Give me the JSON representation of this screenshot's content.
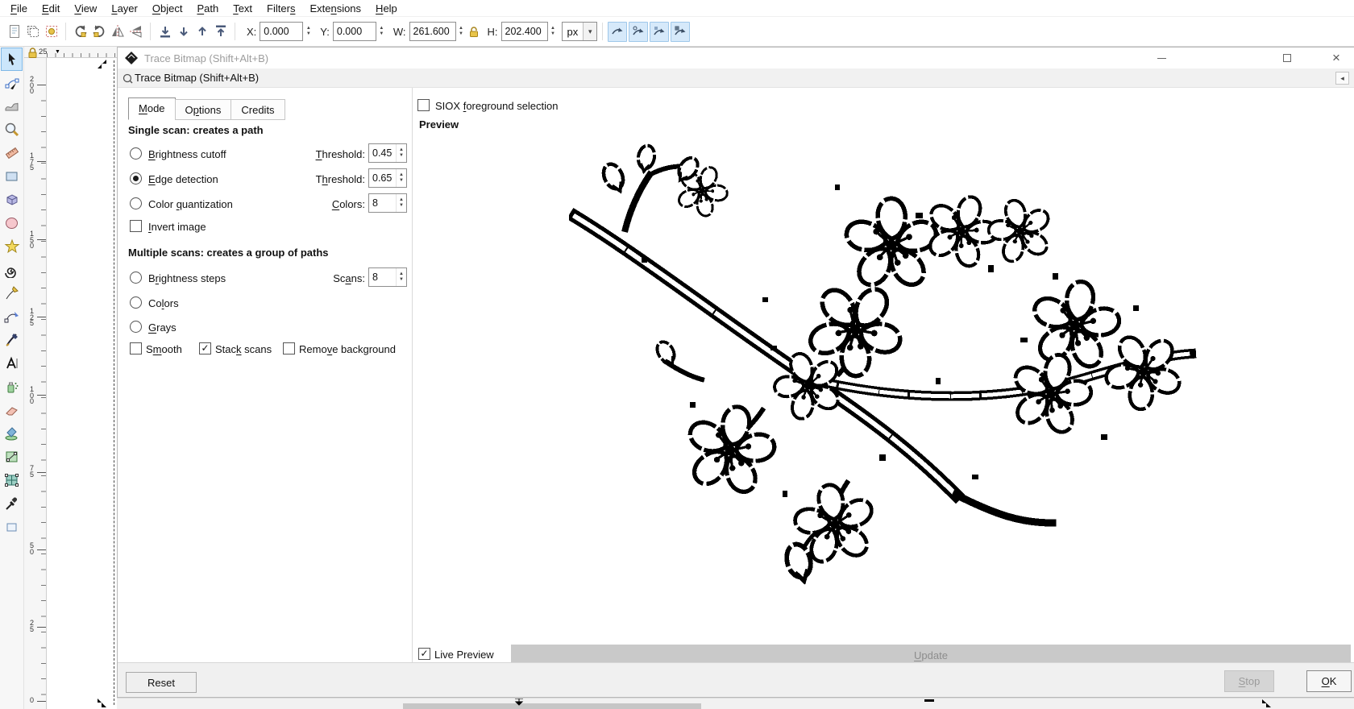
{
  "icons": {
    "check": "✓",
    "close": "×",
    "minimize": "—",
    "spin_up": "▲",
    "spin_down": "▼",
    "dropdown_arrow": "▾",
    "collapse_left": "◂",
    "hruler_marker": "▼"
  },
  "colors": {
    "toggle_blue": "#d6e9fa",
    "tool_selected_blue": "#cbe6fb",
    "disabled_button_bg": "#c9c9c9",
    "disabled_button_text": "#8d8d8d"
  },
  "menu": {
    "items": [
      {
        "t": "File",
        "m": "F"
      },
      {
        "t": "Edit",
        "m": "E"
      },
      {
        "t": "View",
        "m": "V"
      },
      {
        "t": "Layer",
        "m": "L"
      },
      {
        "t": "Object",
        "m": "O"
      },
      {
        "t": "Path",
        "m": "P"
      },
      {
        "t": "Text",
        "m": "T"
      },
      {
        "t": "Filters",
        "m": "s"
      },
      {
        "t": "Extensions",
        "m": "n"
      },
      {
        "t": "Help",
        "m": "H"
      }
    ]
  },
  "toolbar": {
    "x_label": "X:",
    "x_value": "0.000",
    "y_label": "Y:",
    "y_value": "0.000",
    "w_label": "W:",
    "w_value": "261.600",
    "h_label": "H:",
    "h_value": "202.400",
    "unit_value": "px"
  },
  "rulers": {
    "h_origin_label": "25",
    "v_labels": [
      "200",
      "175",
      "150",
      "125",
      "100",
      "75",
      "50",
      "25",
      "0"
    ]
  },
  "window": {
    "title": "Trace Bitmap (Shift+Alt+B)"
  },
  "panel": {
    "title": "Trace Bitmap (Shift+Alt+B)"
  },
  "dialog": {
    "tabs": [
      {
        "t": "Mode",
        "m": "M"
      },
      {
        "t": "Options",
        "m": "p"
      },
      {
        "t": "Credits",
        "m": ""
      }
    ],
    "single": {
      "heading": "Single scan: creates a path",
      "brightness_cutoff": {
        "label": {
          "t": "Brightness cutoff",
          "m": "B"
        },
        "selected": false,
        "param_label": {
          "t": "Threshold:",
          "m": "T"
        },
        "param_value": "0.450"
      },
      "edge_detection": {
        "label": {
          "t": "Edge detection",
          "m": "E"
        },
        "selected": true,
        "param_label": {
          "t": "Threshold:",
          "m": "h"
        },
        "param_value": "0.650"
      },
      "color_quantization": {
        "label": {
          "t": "Color quantization",
          "m": "q"
        },
        "selected": false,
        "param_label": {
          "t": "Colors:",
          "m": "C"
        },
        "param_value": "8"
      },
      "invert": {
        "label": {
          "t": "Invert image",
          "m": "I"
        },
        "checked": false
      }
    },
    "multiple": {
      "heading": "Multiple scans: creates a group of paths",
      "brightness_steps": {
        "label": {
          "t": "Brightness steps",
          "m": "r"
        },
        "selected": false,
        "param_label": {
          "t": "Scans:",
          "m": "a"
        },
        "param_value": "8"
      },
      "colors": {
        "label": {
          "t": "Colors",
          "m": "l"
        },
        "selected": false
      },
      "grays": {
        "label": {
          "t": "Grays",
          "m": "G"
        },
        "selected": false
      },
      "smooth": {
        "label": {
          "t": "Smooth",
          "m": "m"
        },
        "checked": false
      },
      "stack_scans": {
        "label": {
          "t": "Stack scans",
          "m": "k"
        },
        "checked": true
      },
      "remove_background": {
        "label": {
          "t": "Remove background",
          "m": "v"
        },
        "checked": false
      }
    },
    "siox": {
      "label": {
        "t": "SIOX foreground selection",
        "m": "f"
      },
      "checked": false
    },
    "preview_heading": "Preview",
    "live_preview": {
      "label": "Live Preview",
      "checked": true
    },
    "update_label": {
      "t": "Update",
      "m": "U"
    },
    "reset_label": "Reset",
    "stop_label": {
      "t": "Stop",
      "m": "S"
    },
    "ok_label": {
      "t": "OK",
      "m": "O"
    }
  }
}
